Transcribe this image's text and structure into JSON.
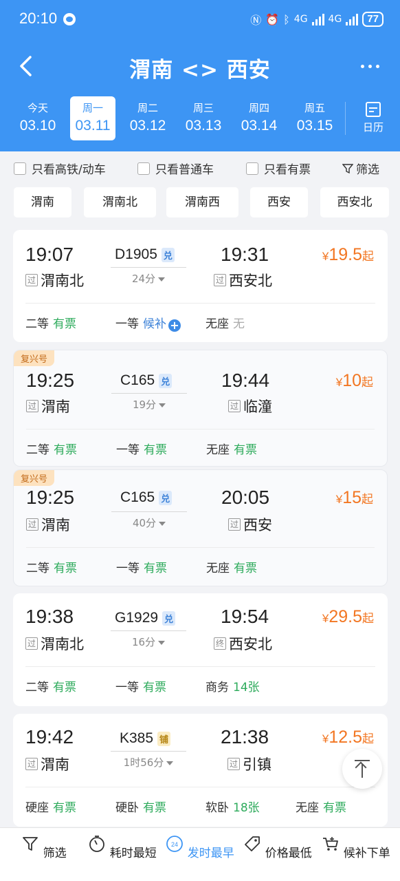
{
  "status_bar": {
    "time": "20:10",
    "network": "4G",
    "battery": "77"
  },
  "header": {
    "title": "渭南 <> 西安"
  },
  "dates": [
    {
      "weekday": "今天",
      "date": "03.10"
    },
    {
      "weekday": "周一",
      "date": "03.11"
    },
    {
      "weekday": "周二",
      "date": "03.12"
    },
    {
      "weekday": "周三",
      "date": "03.13"
    },
    {
      "weekday": "周四",
      "date": "03.14"
    },
    {
      "weekday": "周五",
      "date": "03.15"
    }
  ],
  "calendar_label": "日历",
  "filters": {
    "high_speed": "只看高铁/动车",
    "normal": "只看普通车",
    "available": "只看有票",
    "filter": "筛选"
  },
  "stations": [
    "渭南",
    "渭南北",
    "渭南西",
    "西安",
    "西安北"
  ],
  "trains": [
    {
      "tag": "",
      "dep_time": "19:07",
      "dep_station": "渭南北",
      "dep_tag": "过",
      "train_no": "D1905",
      "badge": "兑",
      "duration": "24分",
      "arr_time": "19:31",
      "arr_station": "西安北",
      "arr_tag": "过",
      "price_cur": "¥",
      "price": "19.5",
      "price_suffix": "起",
      "seats": [
        {
          "name": "二等",
          "status": "有票"
        },
        {
          "name": "一等",
          "status": "候补"
        },
        {
          "name": "无座",
          "status": "无"
        }
      ]
    },
    {
      "tag": "复兴号",
      "dep_time": "19:25",
      "dep_station": "渭南",
      "dep_tag": "过",
      "train_no": "C165",
      "badge": "兑",
      "duration": "19分",
      "arr_time": "19:44",
      "arr_station": "临潼",
      "arr_tag": "过",
      "price_cur": "¥",
      "price": "10",
      "price_suffix": "起",
      "seats": [
        {
          "name": "二等",
          "status": "有票"
        },
        {
          "name": "一等",
          "status": "有票"
        },
        {
          "name": "无座",
          "status": "有票"
        }
      ]
    },
    {
      "tag": "复兴号",
      "dep_time": "19:25",
      "dep_station": "渭南",
      "dep_tag": "过",
      "train_no": "C165",
      "badge": "兑",
      "duration": "40分",
      "arr_time": "20:05",
      "arr_station": "西安",
      "arr_tag": "过",
      "price_cur": "¥",
      "price": "15",
      "price_suffix": "起",
      "seats": [
        {
          "name": "二等",
          "status": "有票"
        },
        {
          "name": "一等",
          "status": "有票"
        },
        {
          "name": "无座",
          "status": "有票"
        }
      ]
    },
    {
      "tag": "",
      "dep_time": "19:38",
      "dep_station": "渭南北",
      "dep_tag": "过",
      "train_no": "G1929",
      "badge": "兑",
      "duration": "16分",
      "arr_time": "19:54",
      "arr_station": "西安北",
      "arr_tag": "终",
      "price_cur": "¥",
      "price": "29.5",
      "price_suffix": "起",
      "seats": [
        {
          "name": "二等",
          "status": "有票"
        },
        {
          "name": "一等",
          "status": "有票"
        },
        {
          "name": "商务",
          "status": "14张"
        }
      ]
    },
    {
      "tag": "",
      "dep_time": "19:42",
      "dep_station": "渭南",
      "dep_tag": "过",
      "train_no": "K385",
      "badge": "铺",
      "duration": "1时56分",
      "arr_time": "21:38",
      "arr_station": "引镇",
      "arr_tag": "过",
      "price_cur": "¥",
      "price": "12.5",
      "price_suffix": "起",
      "seats": [
        {
          "name": "硬座",
          "status": "有票"
        },
        {
          "name": "硬卧",
          "status": "有票"
        },
        {
          "name": "软卧",
          "status": "18张"
        },
        {
          "name": "无座",
          "status": "有票"
        }
      ]
    }
  ],
  "bottom_bar": [
    {
      "label": "筛选",
      "icon": "filter-icon"
    },
    {
      "label": "耗时最短",
      "icon": "timer-icon"
    },
    {
      "label": "发时最早",
      "icon": "clock-24-icon"
    },
    {
      "label": "价格最低",
      "icon": "price-tag-icon"
    },
    {
      "label": "候补下单",
      "icon": "cart-icon"
    }
  ],
  "colors": {
    "primary": "#3d95f4",
    "price": "#f27622",
    "available": "#2eab5c",
    "waitlist": "#3d82d8"
  }
}
